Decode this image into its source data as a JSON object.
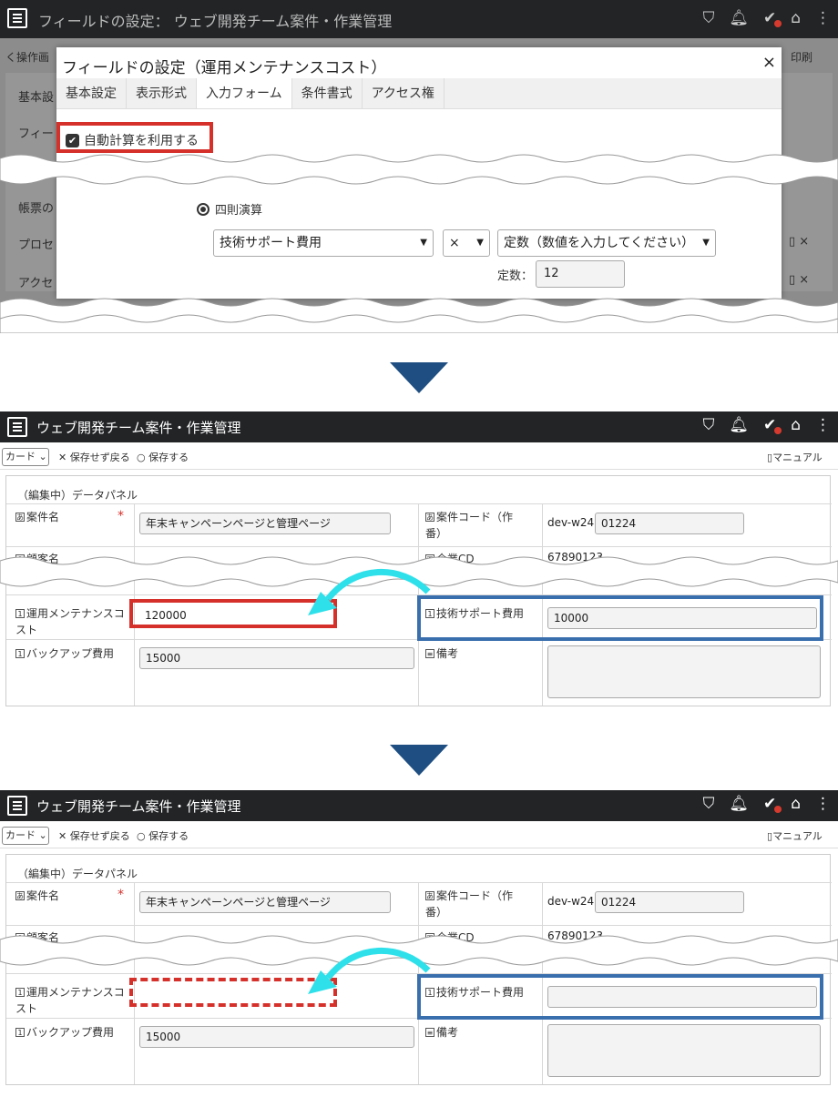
{
  "panel1": {
    "title_bar": "フィールドの設定：  ウェブ開発チーム案件・作業管理",
    "bg_left1": "く操作画",
    "bg_left2": "基本設",
    "bg_left3": "フィー",
    "bg_left4": "帳票の",
    "bg_left5": "プロセ",
    "bg_left6": "アクセ",
    "bg_print": "印刷",
    "modal_title": "フィールドの設定（運用メンテナンスコスト）",
    "close": "×",
    "tabs": [
      "基本設定",
      "表示形式",
      "入力フォーム",
      "条件書式",
      "アクセス権"
    ],
    "auto_calc": "自動計算を利用する",
    "radio": "四則演算",
    "field_select": "技術サポート費用",
    "op_select": "×",
    "const_select": "定数（数値を入力してください）",
    "const_label": "定数：",
    "const_value": "12"
  },
  "app": {
    "title": "ウェブ開発チーム案件・作業管理",
    "view_select": "カード",
    "discard": "保存せず戻る",
    "save": "保存する",
    "manual": "マニュアル",
    "panel_caption": "（編集中）データパネル",
    "f_name_label": "案件名",
    "f_name_value": "年末キャンペーンページと管理ページ",
    "f_code_label": "案件コード（作番）",
    "f_code_prefix": "dev-w24",
    "f_code_value": "01224",
    "f_client_label": "顧客名",
    "f_company_label": "企業CD",
    "f_company_value": "67890123",
    "f_maint_label": "運用メンテナンスコスト",
    "f_tech_label": "技術サポート費用",
    "f_backup_label": "バックアップ費用",
    "f_backup_value": "15000",
    "f_note_label": "備考"
  },
  "panel2": {
    "maint_value": "120000",
    "tech_value": "10000"
  },
  "panel3": {
    "maint_value": "",
    "tech_value": ""
  }
}
